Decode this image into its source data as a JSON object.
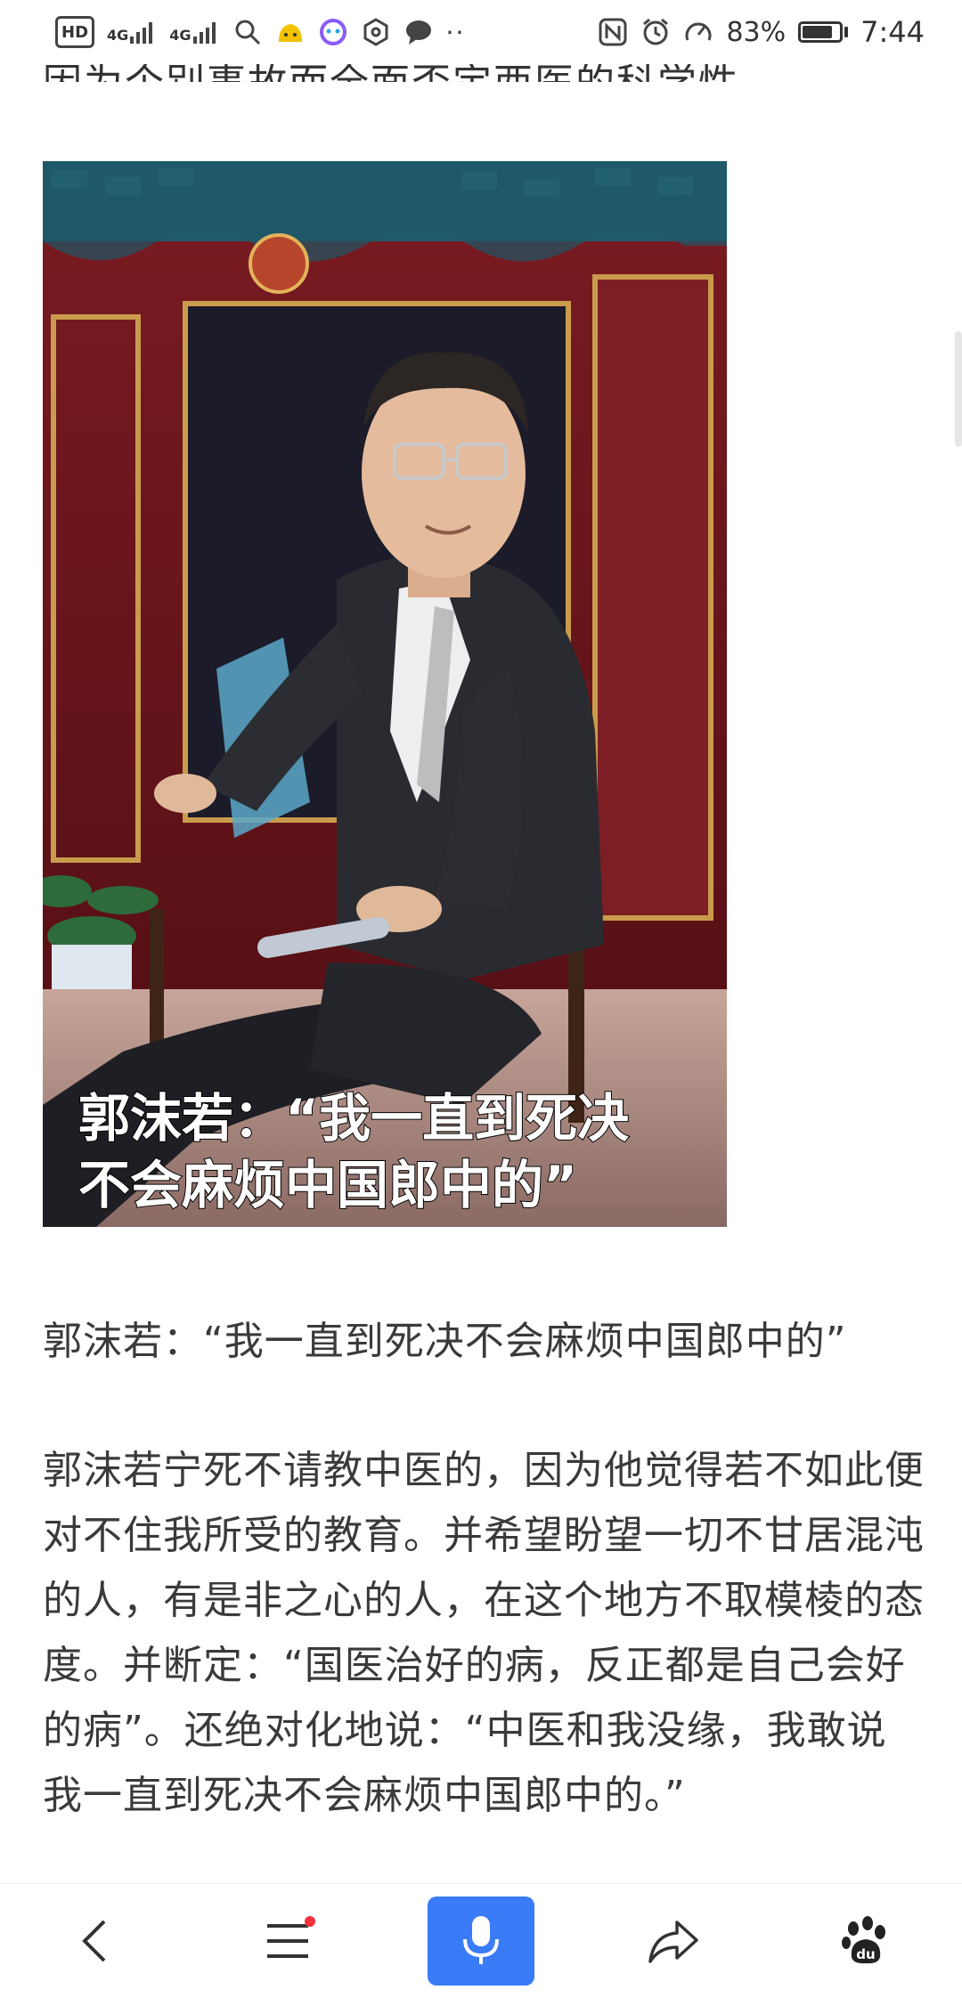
{
  "status_bar": {
    "hd_label": "HD",
    "net1": "4G",
    "net2": "4G",
    "battery_percent": "83%",
    "battery_level": 0.83,
    "time": "7:44",
    "icons": [
      "hd-icon",
      "signal-icon",
      "signal-icon",
      "search-icon",
      "app-icon",
      "app-icon",
      "settings-icon",
      "chat-icon",
      "more-dots-icon",
      "nfc-icon",
      "alarm-icon",
      "speed-icon",
      "battery-icon"
    ]
  },
  "article": {
    "cut_line": "因为个别事故而全面否定西医的科学性。",
    "image_overlay_line1": "郭沫若：“我一直到死决",
    "image_overlay_line2": "不会麻烦中国郎中的”",
    "caption": "郭沫若：“我一直到死决不会麻烦中国郎中的”",
    "paragraph": "郭沫若宁死不请教中医的，因为他觉得若不如此便对不住我所受的教育。并希望盼望一切不甘居混沌的人，有是非之心的人，在这个地方不取模棱的态度。并断定：“国医治好的病，反正都是自己会好的病”。还绝对化地说：“中医和我没缘，我敢说我一直到死决不会麻烦中国郎中的。”"
  },
  "bottom_bar": {
    "items": [
      "back-icon",
      "menu-icon",
      "mic-icon",
      "share-icon",
      "baidu-paw-icon"
    ],
    "accent": "#3a7cf7",
    "notify_color": "#f5303c"
  }
}
